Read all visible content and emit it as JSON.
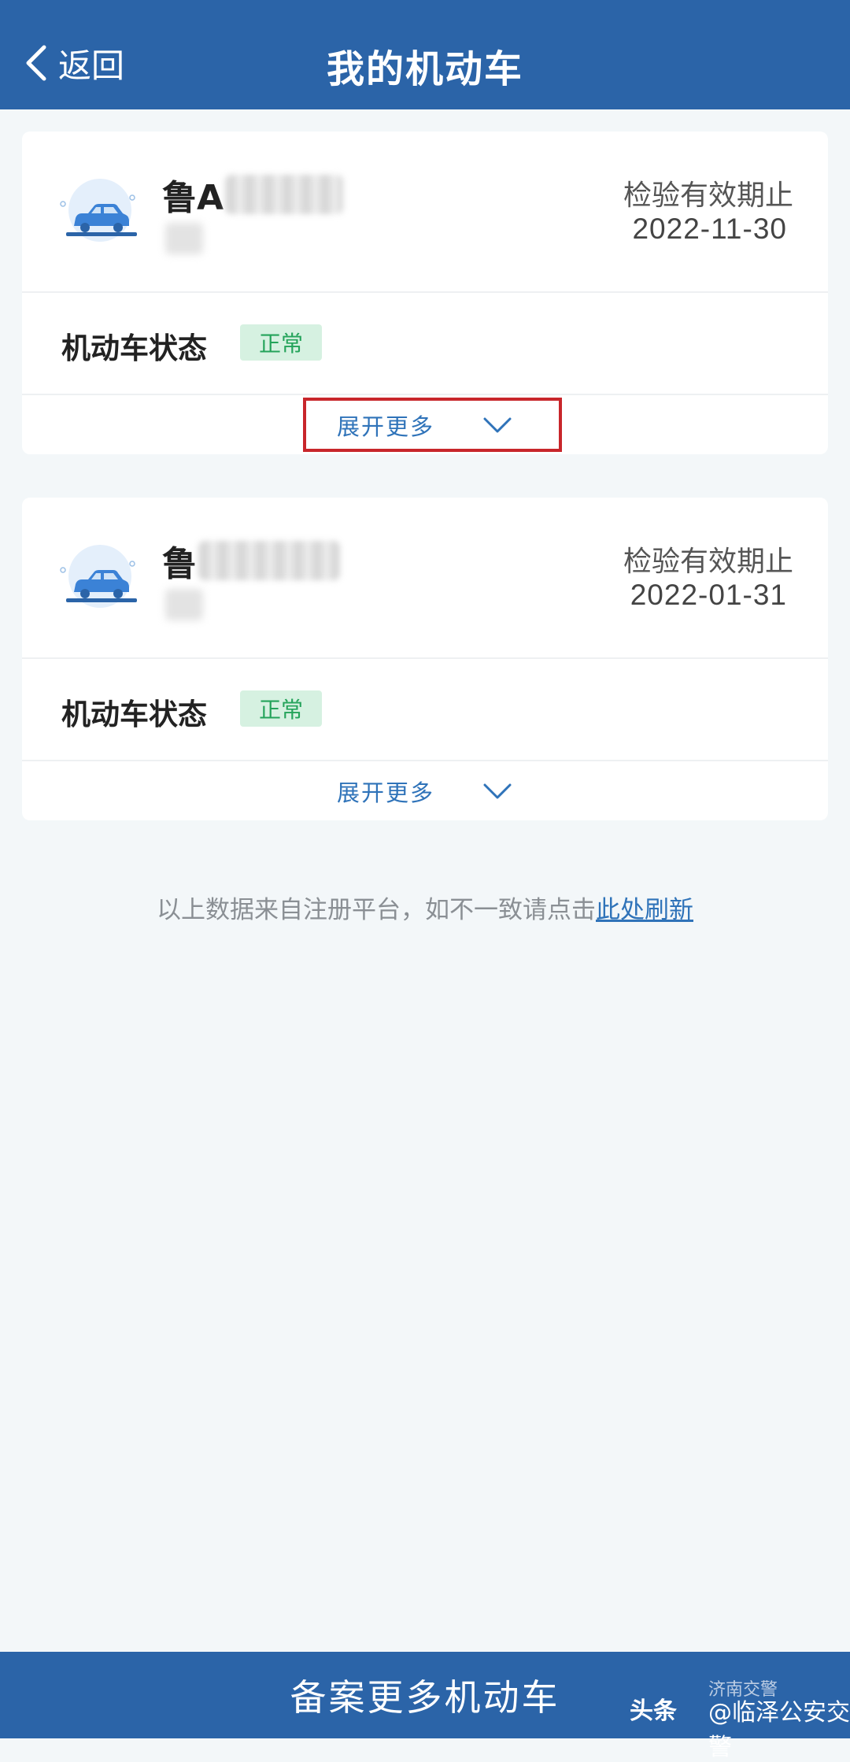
{
  "header": {
    "back_label": "返回",
    "title": "我的机动车"
  },
  "vehicles": [
    {
      "plate_prefix": "鲁A",
      "inspection_label": "检验有效期止",
      "inspection_date": "2022-11-30",
      "status_label": "机动车状态",
      "status_value": "正常",
      "expand_label": "展开更多",
      "highlighted": true
    },
    {
      "plate_prefix": "鲁",
      "inspection_label": "检验有效期止",
      "inspection_date": "2022-01-31",
      "status_label": "机动车状态",
      "status_value": "正常",
      "expand_label": "展开更多",
      "highlighted": false
    }
  ],
  "footnote": {
    "text": "以上数据来自注册平台，如不一致请点击",
    "link": "此处刷新"
  },
  "bottom_button": {
    "label": "备案更多机动车"
  },
  "watermark": {
    "source": "头条",
    "wechat_account": "济南交警",
    "account": "@临泽公安交警"
  },
  "colors": {
    "primary": "#2b64a8",
    "link": "#2f73b9",
    "status_bg": "#d6f1e1",
    "status_text": "#24a35a",
    "highlight": "#c8262b"
  },
  "icons": {
    "back": "chevron-left-icon",
    "expand": "chevron-down-icon",
    "vehicle": "car-icon"
  }
}
